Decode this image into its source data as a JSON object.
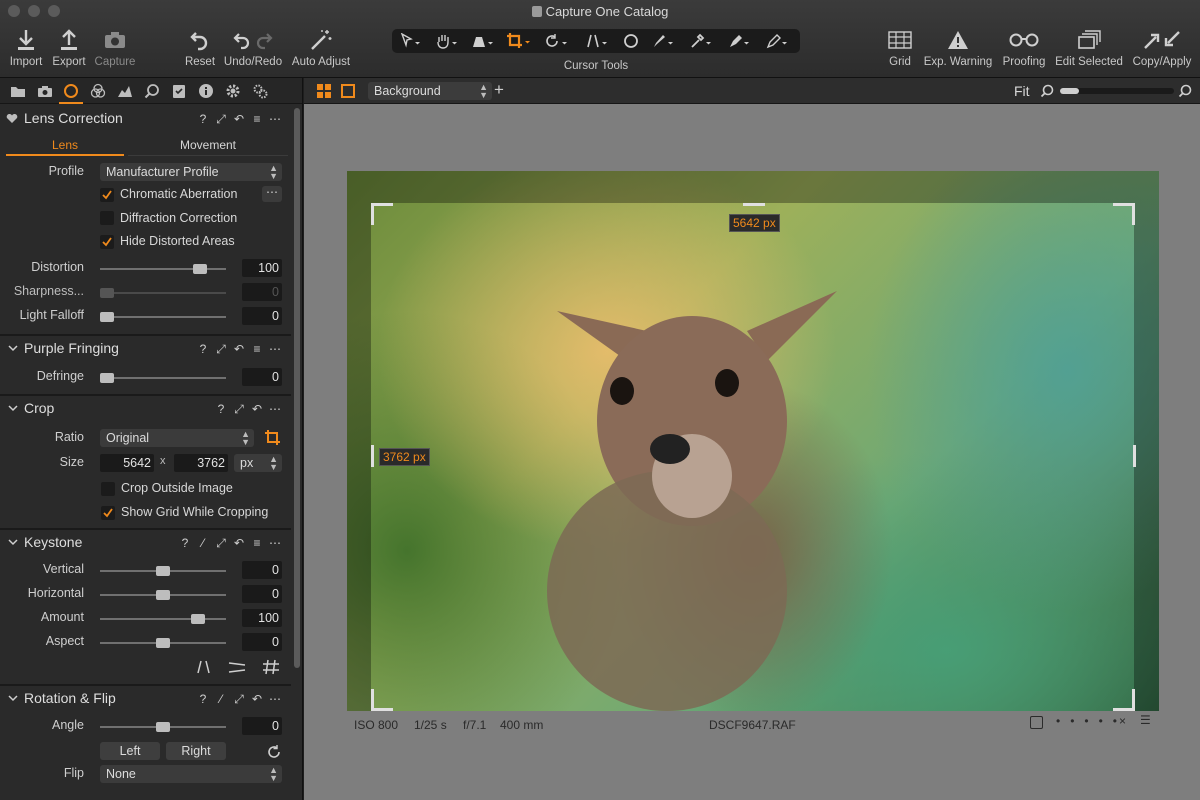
{
  "window": {
    "title": "Capture One Catalog"
  },
  "toolbar": {
    "import": "Import",
    "export": "Export",
    "capture": "Capture",
    "reset": "Reset",
    "undo_redo": "Undo/Redo",
    "auto_adjust": "Auto Adjust",
    "cursor_tools": "Cursor Tools",
    "grid": "Grid",
    "exp_warning": "Exp. Warning",
    "proofing": "Proofing",
    "edit_selected": "Edit Selected",
    "copy_apply": "Copy/Apply"
  },
  "viewer_bar": {
    "background": "Background",
    "fit": "Fit",
    "zoom_fraction": 0.17
  },
  "lens_correction": {
    "title": "Lens Correction",
    "tab_lens": "Lens",
    "tab_movement": "Movement",
    "profile_label": "Profile",
    "profile_value": "Manufacturer Profile",
    "chromatic_aberration": "Chromatic Aberration",
    "diffraction_correction": "Diffraction Correction",
    "hide_distorted_areas": "Hide Distorted Areas",
    "distortion_label": "Distortion",
    "distortion_value": "100",
    "sharpness_label": "Sharpness...",
    "sharpness_value": "0",
    "light_falloff_label": "Light Falloff",
    "light_falloff_value": "0"
  },
  "purple_fringing": {
    "title": "Purple Fringing",
    "defringe_label": "Defringe",
    "defringe_value": "0"
  },
  "crop": {
    "title": "Crop",
    "ratio_label": "Ratio",
    "ratio_value": "Original",
    "size_label": "Size",
    "width": "5642",
    "x": "x",
    "height": "3762",
    "unit": "px",
    "crop_outside_image": "Crop Outside Image",
    "show_grid_while_cropping": "Show Grid While Cropping"
  },
  "keystone": {
    "title": "Keystone",
    "vertical_label": "Vertical",
    "vertical_value": "0",
    "horizontal_label": "Horizontal",
    "horizontal_value": "0",
    "amount_label": "Amount",
    "amount_value": "100",
    "aspect_label": "Aspect",
    "aspect_value": "0"
  },
  "rotation_flip": {
    "title": "Rotation & Flip",
    "angle_label": "Angle",
    "angle_value": "0",
    "left": "Left",
    "right": "Right",
    "flip_label": "Flip",
    "flip_value": "None"
  },
  "image": {
    "crop_width_tag": "5642 px",
    "crop_height_tag": "3762 px",
    "iso": "ISO 800",
    "shutter": "1/25 s",
    "aperture": "f/7.1",
    "focal": "400 mm",
    "filename": "DSCF9647.RAF"
  },
  "colors": {
    "accent": "#f08a1c",
    "panel": "#2a2a2a",
    "viewer": "#7e7e7e"
  }
}
